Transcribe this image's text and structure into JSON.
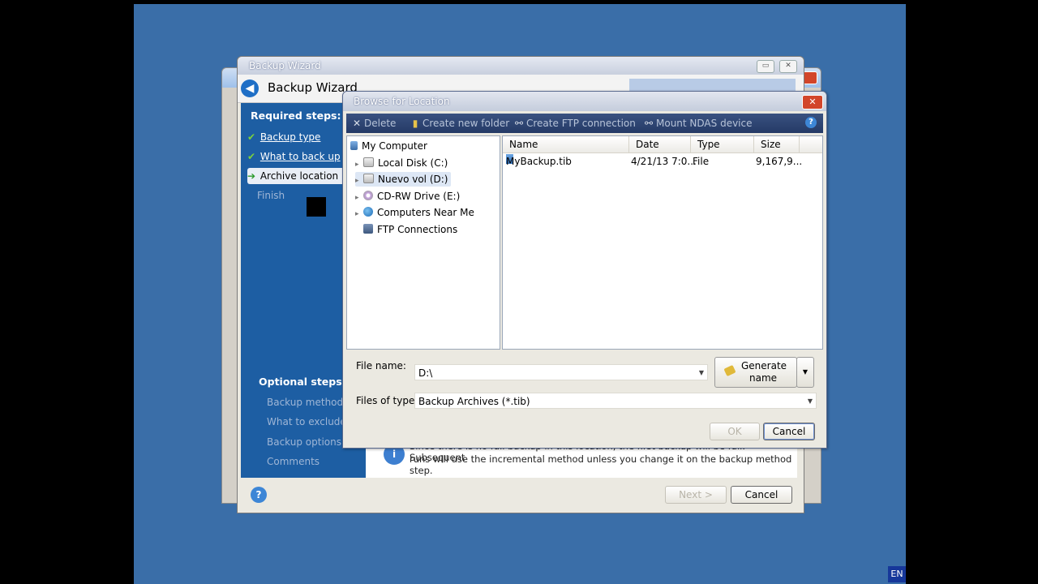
{
  "wizard": {
    "window_title": "Backup Wizard",
    "header_title": "Backup Wizard",
    "required_heading": "Required steps:",
    "required_steps": [
      {
        "label": "Backup type",
        "state": "done"
      },
      {
        "label": "What to back up",
        "state": "done"
      },
      {
        "label": "Archive location",
        "state": "current"
      },
      {
        "label": "Finish",
        "state": "pending"
      }
    ],
    "optional_heading": "Optional steps:",
    "optional_steps": [
      "Backup method",
      "What to exclude",
      "Backup options",
      "Comments"
    ],
    "info_line1": "Since there is no full backup in this location, the first backup will be full. Subsequent",
    "info_line2": "runs will use the incremental method unless you change it on the backup method step.",
    "next_label": "Next >",
    "cancel_label": "Cancel"
  },
  "browse": {
    "title": "Browse for Location",
    "toolbar": [
      {
        "label": "Delete",
        "icon": "delete-icon",
        "glyph": "✕"
      },
      {
        "label": "Create new folder",
        "icon": "new-folder-icon",
        "glyph": "▮"
      },
      {
        "label": "Create FTP connection",
        "icon": "ftp-connection-icon",
        "glyph": "⚯"
      },
      {
        "label": "Mount NDAS device",
        "icon": "ndas-device-icon",
        "glyph": "⚯"
      }
    ],
    "tree": {
      "root": "My Computer",
      "items": [
        {
          "label": "Local Disk (C:)",
          "icon": "disk"
        },
        {
          "label": "Nuevo vol (D:)",
          "icon": "disk",
          "selected": true
        },
        {
          "label": "CD-RW Drive (E:)",
          "icon": "cd"
        },
        {
          "label": "Computers Near Me",
          "icon": "globe"
        },
        {
          "label": "FTP Connections",
          "icon": "ftp"
        }
      ]
    },
    "columns": [
      "Name",
      "Date",
      "Type",
      "Size"
    ],
    "files": [
      {
        "name": "MyBackup.tib",
        "date": "4/21/13 7:0...",
        "type": "File",
        "size": "9,167,9..."
      }
    ],
    "file_name_label": "File name:",
    "file_name_value": "D:\\",
    "files_of_type_label": "Files of type:",
    "files_of_type_value": "Backup Archives (*.tib)",
    "generate_line1": "Generate",
    "generate_line2": "name",
    "ok_label": "OK",
    "cancel_label": "Cancel"
  },
  "taskbar": {
    "language": "EN"
  },
  "colors": {
    "sidebar": "#1d5ea3",
    "desktop": "#3a6ea8",
    "toolbar": "#2c4372"
  }
}
